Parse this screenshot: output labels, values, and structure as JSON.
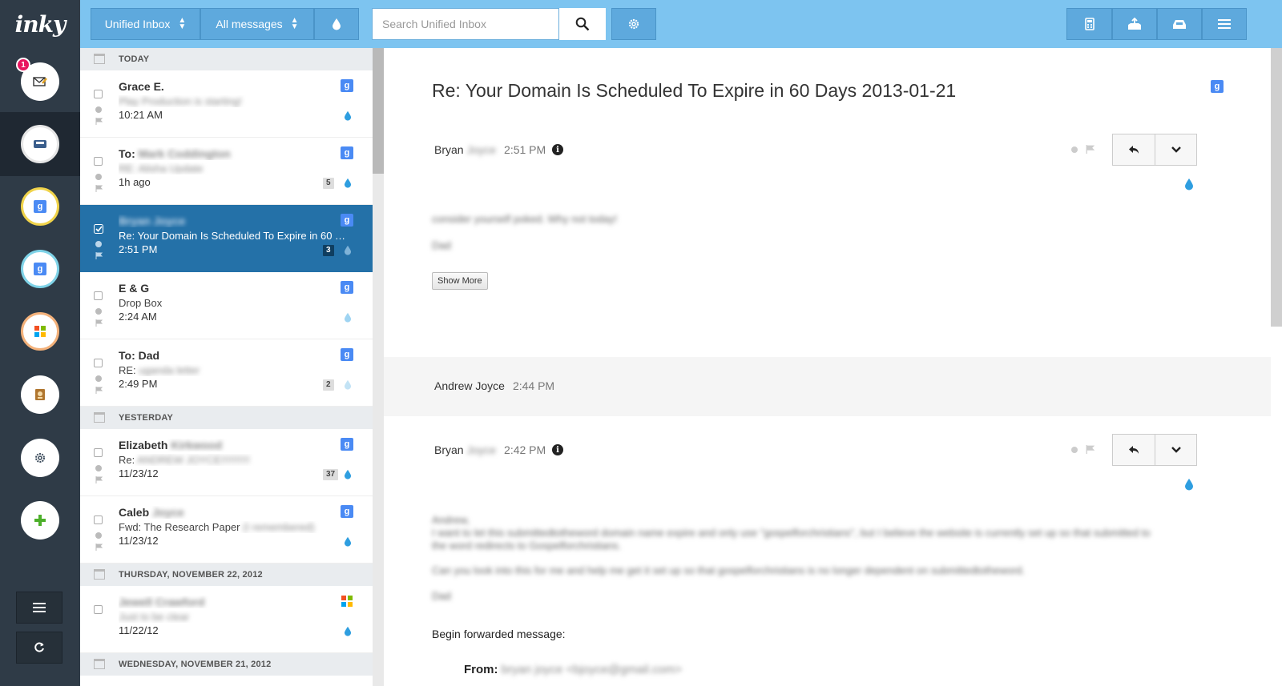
{
  "app": {
    "logo": "inky"
  },
  "rail": {
    "compose_badge": "1",
    "accounts": [
      {
        "name": "compose-mail",
        "icon": "compose-mail-icon"
      },
      {
        "name": "unified-inbox",
        "icon": "inbox-tray-icon"
      },
      {
        "name": "google-account-1",
        "icon": "google-icon"
      },
      {
        "name": "google-account-2",
        "icon": "google-icon"
      },
      {
        "name": "windows-account",
        "icon": "windows-icon"
      },
      {
        "name": "contacts",
        "icon": "address-book-icon"
      },
      {
        "name": "settings",
        "icon": "gear-icon"
      },
      {
        "name": "add-account",
        "icon": "plus-icon"
      }
    ]
  },
  "toolbar": {
    "mailbox_select": "Unified Inbox",
    "filter_select": "All messages",
    "search_placeholder": "Search Unified Inbox",
    "right_icons": [
      "calculator-icon",
      "inbox-upload-icon",
      "inbox-tray-icon",
      "menu-icon"
    ]
  },
  "list": {
    "groups": [
      {
        "label": "TODAY"
      },
      {
        "label": "YESTERDAY"
      },
      {
        "label": "THURSDAY, NOVEMBER 22, 2012"
      },
      {
        "label": "WEDNESDAY, NOVEMBER 21, 2012"
      }
    ],
    "messages": [
      {
        "from": "Grace E.",
        "from_blur": "",
        "subject": "",
        "subject_blur": "Play Production is starting!",
        "time": "10:21 AM",
        "count": "",
        "service": "google"
      },
      {
        "from": "To:",
        "from_blur": "Mark Coddington",
        "subject": "",
        "subject_blur": "RE: Alisha Update",
        "time": "1h ago",
        "count": "5",
        "service": "google"
      },
      {
        "from": "",
        "from_blur": "Bryan Joyce",
        "subject": "Re: Your Domain Is Scheduled To Expire in 60 Days 2013-01-21",
        "subject_blur": "",
        "time": "2:51 PM",
        "count": "3",
        "service": "google"
      },
      {
        "from": "E & G",
        "from_blur": "",
        "subject": "Drop Box",
        "subject_blur": "",
        "time": "2:24 AM",
        "count": "",
        "service": "google"
      },
      {
        "from": "To: Dad",
        "from_blur": "",
        "subject": "RE:",
        "subject_blur": "uganda letter",
        "time": "2:49 PM",
        "count": "2",
        "service": "google"
      },
      {
        "from": "Elizabeth",
        "from_blur": "Kirkwood",
        "subject": "Re:",
        "subject_blur": "ANDREW JOYCE!!!!!!!!!!",
        "time": "11/23/12",
        "count": "37",
        "service": "google"
      },
      {
        "from": "Caleb",
        "from_blur": "Joyce",
        "subject": "Fwd: The Research Paper",
        "subject_blur": "(I remembered)",
        "time": "11/23/12",
        "count": "",
        "service": "google"
      },
      {
        "from": "",
        "from_blur": "Jewell Crawford",
        "subject": "",
        "subject_blur": "Just to be clear",
        "time": "11/22/12",
        "count": "",
        "service": "windows"
      }
    ]
  },
  "reader": {
    "subject": "Re: Your Domain Is Scheduled To Expire in 60 Days 2013-01-21",
    "thread": [
      {
        "sender": "Bryan",
        "sender_blur": "Joyce",
        "time": "2:51 PM",
        "body": [
          "consider yourself poked.  Why not today!",
          "Dad"
        ],
        "show_more": "Show More"
      },
      {
        "sender": "Andrew Joyce",
        "time": "2:44 PM"
      },
      {
        "sender": "Bryan",
        "sender_blur": "Joyce",
        "time": "2:42 PM",
        "body": [
          "Andrew,",
          "I want to let this submittedtotheword domain name expire and only use \"gospelforchristians\", but I believe the website is currently set up so that submitted to",
          "the word redirects to Gospelforchristians.",
          "Can you look into this for me and help me get it set up so that gospelforchristians is no longer dependent on submittedtotheword.",
          "Dad"
        ],
        "forward_label": "Begin forwarded message:",
        "from_label": "From:",
        "from_blur": "bryan joyce <bjoyce@gmail.com>"
      }
    ]
  },
  "colors": {
    "topbar": "#7dc4f0",
    "rail": "#2f3b47",
    "selected_row": "#2471a8",
    "badge": "#e8155f"
  }
}
